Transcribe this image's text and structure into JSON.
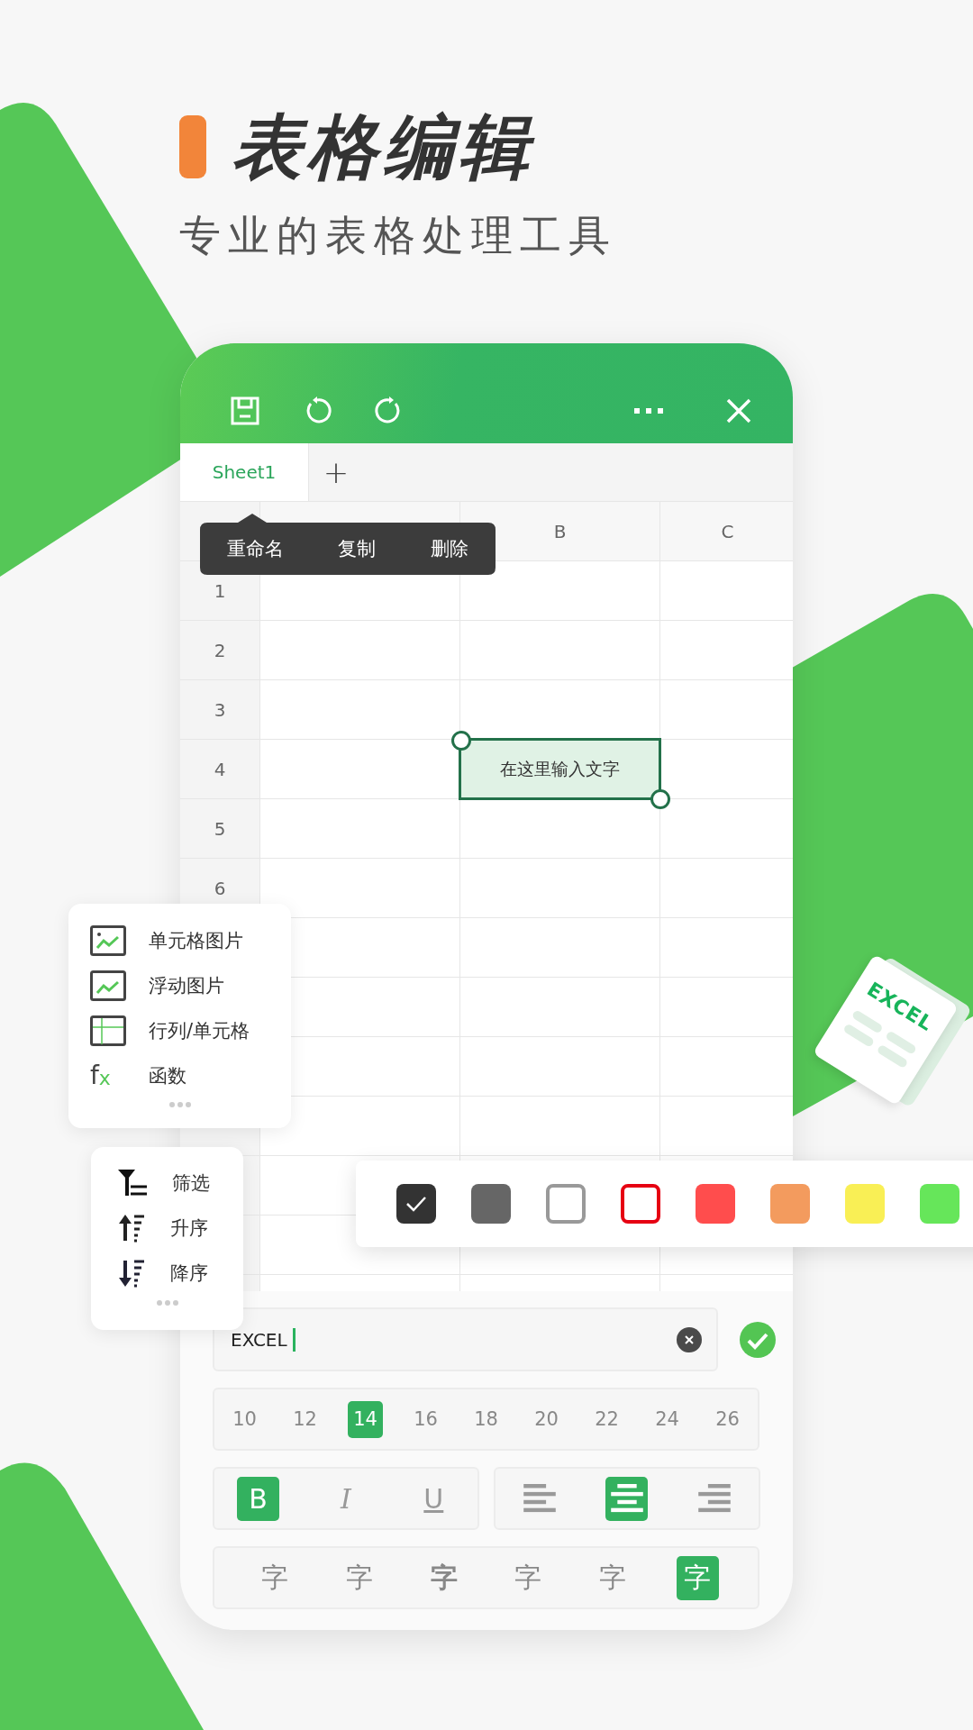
{
  "headline": {
    "title": "表格编辑",
    "subtitle": "专业的表格处理工具"
  },
  "sheet_tabs": [
    {
      "label": "Sheet1",
      "selected": true
    }
  ],
  "add_sheet": "+",
  "context_menu": [
    "重命名",
    "复制",
    "删除"
  ],
  "column_headers": [
    "B",
    "C"
  ],
  "row_numbers": [
    "1",
    "2",
    "3",
    "4",
    "5",
    "6"
  ],
  "active_cell": {
    "text": "在这里输入文字"
  },
  "insert_menu": [
    {
      "kind": "cell-picture",
      "label": "单元格图片"
    },
    {
      "kind": "floating-picture",
      "label": "浮动图片"
    },
    {
      "kind": "table",
      "label": "行列/单元格"
    },
    {
      "kind": "function",
      "symbol": "fx",
      "label": "函数"
    }
  ],
  "sort_menu": [
    {
      "kind": "filter",
      "label": "筛选"
    },
    {
      "kind": "ascending",
      "label": "升序"
    },
    {
      "kind": "descending",
      "label": "降序"
    }
  ],
  "palette": [
    {
      "kind": "fill",
      "color": "#333333",
      "selected": true
    },
    {
      "kind": "fill",
      "color": "#666666",
      "selected": false
    },
    {
      "kind": "outline",
      "color": "#999999",
      "selected": false
    },
    {
      "kind": "outline",
      "color": "#e60012",
      "selected": false
    },
    {
      "kind": "fill",
      "color": "#ff4d4d",
      "selected": false
    },
    {
      "kind": "fill",
      "color": "#f39b5e",
      "selected": false
    },
    {
      "kind": "fill",
      "color": "#f9ef55",
      "selected": false
    },
    {
      "kind": "fill",
      "color": "#66e65a",
      "selected": false
    }
  ],
  "text_input": {
    "value": "EXCEL"
  },
  "font_sizes": [
    {
      "label": "10",
      "selected": false
    },
    {
      "label": "12",
      "selected": false
    },
    {
      "label": "14",
      "selected": true
    },
    {
      "label": "16",
      "selected": false
    },
    {
      "label": "18",
      "selected": false
    },
    {
      "label": "20",
      "selected": false
    },
    {
      "label": "22",
      "selected": false
    },
    {
      "label": "24",
      "selected": false
    },
    {
      "label": "26",
      "selected": false
    }
  ],
  "text_styles": [
    {
      "kind": "bold",
      "label": "B",
      "selected": true
    },
    {
      "kind": "italic",
      "label": "I",
      "selected": false
    },
    {
      "kind": "underline",
      "label": "U",
      "selected": false
    }
  ],
  "alignment": [
    {
      "kind": "left",
      "selected": false
    },
    {
      "kind": "center",
      "selected": true
    },
    {
      "kind": "right",
      "selected": false
    }
  ],
  "font_faces": [
    {
      "label": "字",
      "selected": false
    },
    {
      "label": "字",
      "selected": false
    },
    {
      "label": "字",
      "selected": false
    },
    {
      "label": "字",
      "selected": false
    },
    {
      "label": "字",
      "selected": false
    },
    {
      "label": "字",
      "selected": true
    }
  ],
  "file_badge": {
    "label": "EXCEL"
  }
}
